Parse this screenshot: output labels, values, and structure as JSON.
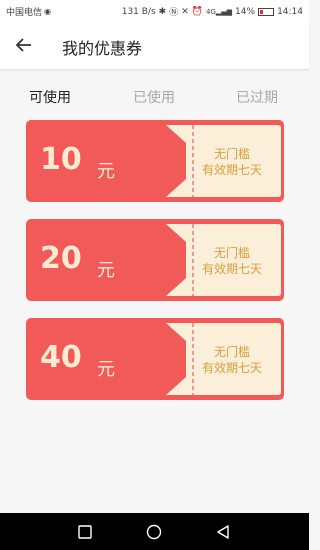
{
  "status": {
    "carrier": "中国电信",
    "speed": "131 B/s",
    "signal_label": "4G",
    "battery": "14%",
    "time": "14:14"
  },
  "header": {
    "title": "我的优惠券"
  },
  "tabs": [
    {
      "label": "可使用",
      "active": true
    },
    {
      "label": "已使用",
      "active": false
    },
    {
      "label": "已过期",
      "active": false
    }
  ],
  "coupons": [
    {
      "amount": "10",
      "unit": "元",
      "line1": "无门槛",
      "line2": "有效期七天"
    },
    {
      "amount": "20",
      "unit": "元",
      "line1": "无门槛",
      "line2": "有效期七天"
    },
    {
      "amount": "40",
      "unit": "元",
      "line1": "无门槛",
      "line2": "有效期七天"
    }
  ],
  "colors": {
    "coupon_bg": "#f25a5a",
    "stub_bg": "#fbefd9",
    "desc_text": "#d8a03c",
    "amount_text": "#fdebd2"
  }
}
